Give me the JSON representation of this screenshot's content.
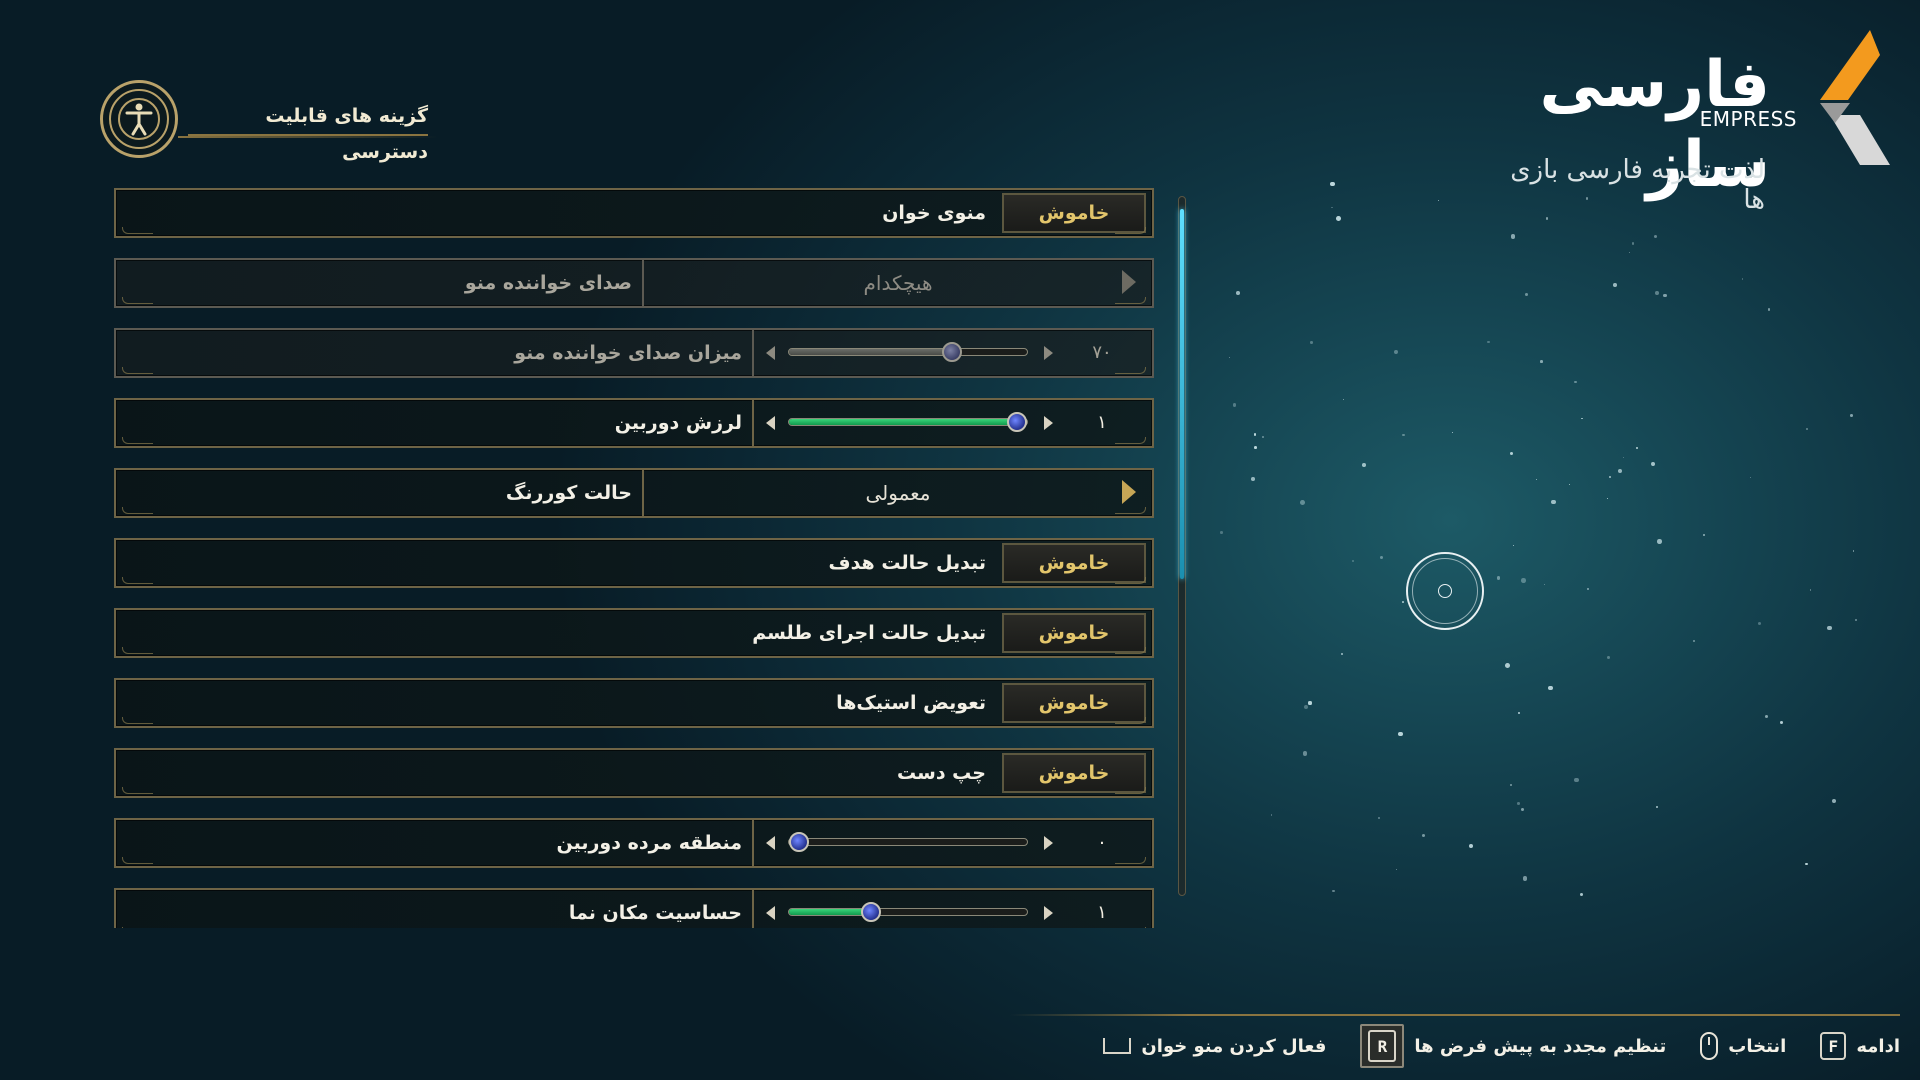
{
  "header": {
    "title": "گزینه های قابلیت دسترسی",
    "icon": "accessibility-icon"
  },
  "logo": {
    "title": "فارسی ساز",
    "badge": "EMPRESS",
    "subtitle": "لذت تجربه فارسی بازی ها"
  },
  "settings": [
    {
      "label": "منوی خوان",
      "type": "toggle",
      "value": "خاموش",
      "enabled": true
    },
    {
      "label": "صدای خواننده منو",
      "type": "selector",
      "value": "هیچکدام",
      "enabled": false
    },
    {
      "label": "میزان صدای خواننده منو",
      "type": "slider",
      "value": "۷۰",
      "level": 0.7,
      "enabled": false
    },
    {
      "label": "لرزش دوربین",
      "type": "slider",
      "value": "۱",
      "level": 1.0,
      "enabled": true
    },
    {
      "label": "حالت کوررنگ",
      "type": "selector",
      "value": "معمولی",
      "enabled": true
    },
    {
      "label": "تبدیل حالت هدف",
      "type": "toggle",
      "value": "خاموش",
      "enabled": true
    },
    {
      "label": "تبدیل حالت اجرای طلسم",
      "type": "toggle",
      "value": "خاموش",
      "enabled": true
    },
    {
      "label": "تعویض استیک‌ها",
      "type": "toggle",
      "value": "خاموش",
      "enabled": true
    },
    {
      "label": "چپ دست",
      "type": "toggle",
      "value": "خاموش",
      "enabled": true
    },
    {
      "label": "منطقه مرده دوربین",
      "type": "slider",
      "value": "۰",
      "level": 0.0,
      "enabled": true
    },
    {
      "label": "حساسیت مکان نما",
      "type": "slider",
      "value": "۱",
      "level": 0.33,
      "enabled": true
    }
  ],
  "footer": {
    "continue": {
      "label": "ادامه",
      "key": "F"
    },
    "select": {
      "label": "انتخاب",
      "key": "mouse-icon"
    },
    "reset": {
      "label": "تنظیم مجدد به پیش فرض ها",
      "key": "R"
    },
    "reader": {
      "label": "فعال کردن منو خوان",
      "key": "space-key-icon"
    }
  },
  "colors": {
    "accent_gold": "#e2c56b",
    "slider_green": "#3ad57a",
    "scroll_cyan": "#5fe0ff",
    "border_gold": "#6e6446"
  }
}
